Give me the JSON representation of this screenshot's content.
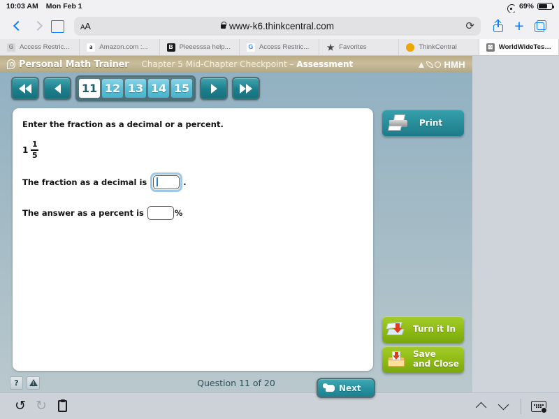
{
  "status_bar": {
    "time": "10:03 AM",
    "date": "Mon Feb 1",
    "battery_percent": "69%",
    "wifi_icon": "wifi-icon",
    "battery_icon": "battery-icon"
  },
  "browser": {
    "back_icon": "chevron-left-icon",
    "forward_icon": "chevron-right-icon",
    "bookmarks_icon": "book-icon",
    "text_size_label": "AA",
    "lock_icon": "lock-icon",
    "url": "www-k6.thinkcentral.com",
    "reload_icon": "reload-icon",
    "share_icon": "share-icon",
    "new_tab_icon": "plus-icon",
    "tabs_icon": "tabs-icon"
  },
  "bookmarks": [
    {
      "label": "Access Restric...",
      "favicon": "g-grey",
      "glyph": "G",
      "active": false
    },
    {
      "label": "Amazon.com :...",
      "favicon": "amazon",
      "glyph": "a",
      "active": false
    },
    {
      "label": "Pleeesssa help...",
      "favicon": "black",
      "glyph": "B",
      "active": false
    },
    {
      "label": "Access Restric...",
      "favicon": "google",
      "glyph": "G",
      "active": false
    },
    {
      "label": "Favorites",
      "favicon": "star",
      "glyph": "★",
      "active": false
    },
    {
      "label": "ThinkCentral",
      "favicon": "dot",
      "glyph": "",
      "active": false
    },
    {
      "label": "WorldWideTest...",
      "favicon": "x",
      "glyph": "⊠",
      "active": true
    }
  ],
  "app": {
    "brand": "Personal Math Trainer",
    "title_plain": "Chapter 5 Mid-Chapter Checkpoint – ",
    "title_bold": "Assessment",
    "logo_text": "HMH"
  },
  "pager": {
    "first_label": "first-page",
    "prev_label": "previous-page",
    "next_label": "next-page",
    "last_label": "last-page",
    "pages": [
      "11",
      "12",
      "13",
      "14",
      "15"
    ],
    "current_page": "11"
  },
  "question": {
    "prompt": "Enter the fraction as a decimal or a percent.",
    "mixed_whole": "1",
    "mixed_numerator": "1",
    "mixed_denominator": "5",
    "decimal_label": "The fraction as a decimal is",
    "decimal_value": "",
    "decimal_suffix": ".",
    "percent_label": "The answer as a percent is",
    "percent_value": "",
    "percent_suffix": "%"
  },
  "rail": {
    "print_label": "Print",
    "print_icon": "printer-icon",
    "turn_in_label": "Turn it In",
    "turn_in_icon": "stack-upload-icon",
    "save_close_line1": "Save",
    "save_close_line2": "and Close",
    "save_close_icon": "folder-download-icon"
  },
  "footer": {
    "help_label": "?",
    "alert_label": "alert",
    "question_counter": "Question 11 of 20",
    "next_label": "Next",
    "next_icon": "thumbs-up-icon"
  },
  "ipad_toolbar": {
    "undo_icon": "↺",
    "redo_icon": "↻",
    "paste_icon": "clipboard-icon",
    "up_icon": "chevron-up-icon",
    "down_icon": "chevron-down-icon",
    "keyboard_icon": "hide-keyboard-icon"
  },
  "colors": {
    "accent_teal": "#2690a0",
    "green_button": "#8fbc14",
    "header_tan": "#b9ab85",
    "page_selected": "#ffffff",
    "page_tile": "#5cc0d8",
    "link_blue": "#0a7cff"
  }
}
